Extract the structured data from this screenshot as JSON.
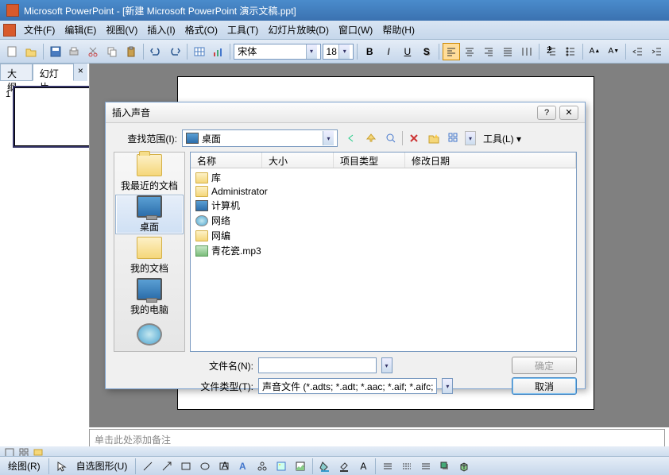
{
  "title": "Microsoft PowerPoint - [新建 Microsoft PowerPoint 演示文稿.ppt]",
  "menu": {
    "file": "文件(F)",
    "edit": "编辑(E)",
    "view": "视图(V)",
    "insert": "插入(I)",
    "format": "格式(O)",
    "tools": "工具(T)",
    "slideshow": "幻灯片放映(D)",
    "window": "窗口(W)",
    "help": "帮助(H)"
  },
  "format_toolbar": {
    "font_name": "宋体",
    "font_size": "18"
  },
  "panel": {
    "outline_tab": "大纲",
    "slides_tab": "幻灯片",
    "slide_num": "1"
  },
  "notes": {
    "placeholder": "单击此处添加备注"
  },
  "drawbar": {
    "draw_menu": "绘图(R)",
    "autoshapes": "自选图形(U)"
  },
  "dialog": {
    "title": "插入声音",
    "look_in_label": "查找范围(I):",
    "look_in_value": "桌面",
    "tools_label": "工具(L)",
    "columns": {
      "name": "名称",
      "size": "大小",
      "type": "项目类型",
      "modified": "修改日期"
    },
    "places": {
      "recent": "我最近的文档",
      "desktop": "桌面",
      "my_docs": "我的文档",
      "my_computer": "我的电脑"
    },
    "items": [
      {
        "label": "库",
        "icon": "folder"
      },
      {
        "label": "Administrator",
        "icon": "folder"
      },
      {
        "label": "计算机",
        "icon": "monitor"
      },
      {
        "label": "网络",
        "icon": "network"
      },
      {
        "label": "网编",
        "icon": "folder"
      },
      {
        "label": "青花瓷.mp3",
        "icon": "audio"
      }
    ],
    "filename_label": "文件名(N):",
    "filetype_label": "文件类型(T):",
    "filetype_value": "声音文件 (*.adts; *.adt; *.aac; *.aif; *.aifc;",
    "ok": "确定",
    "cancel": "取消"
  }
}
